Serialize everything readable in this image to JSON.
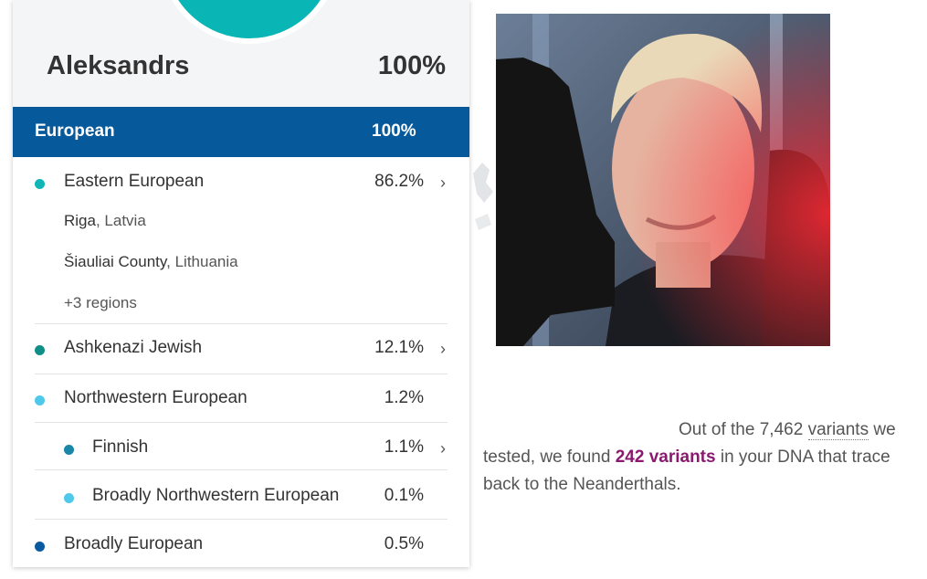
{
  "profile": {
    "name": "Aleksandrs",
    "percent": "100%"
  },
  "group": {
    "label": "European",
    "percent": "100%"
  },
  "rows": {
    "eastern": {
      "name": "Eastern European",
      "percent": "86.2%",
      "color": "#11b5b5",
      "regions": [
        {
          "place": "Riga",
          "country": ", Latvia"
        },
        {
          "place": "Šiauliai County",
          "country": ", Lithuania"
        }
      ],
      "more": "+3 regions"
    },
    "ashkenazi": {
      "name": "Ashkenazi Jewish",
      "percent": "12.1%",
      "color": "#0f8f86"
    },
    "northwestern": {
      "name": "Northwestern European",
      "percent": "1.2%",
      "color": "#4fc8ea"
    },
    "finnish": {
      "name": "Finnish",
      "percent": "1.1%",
      "color": "#1a86a8"
    },
    "broadly_nw": {
      "name": "Broadly Northwestern European",
      "percent": "0.1%",
      "color": "#4fc8ea"
    },
    "broadly_eu": {
      "name": "Broadly European",
      "percent": "0.5%",
      "color": "#0a5aa0"
    }
  },
  "icons": {
    "chevron": "›"
  },
  "neanderthal": {
    "p1": "Out of the ",
    "count": "7,462",
    "link": "variants",
    "p2": " we tested, we found ",
    "found": "242 variants",
    "p3": " in your DNA that trace back to the Neanderthals."
  }
}
